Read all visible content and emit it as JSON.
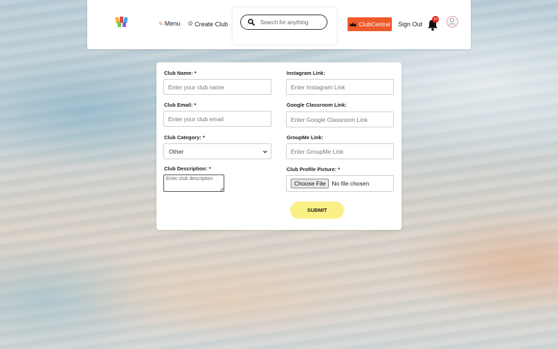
{
  "nav": {
    "menu_label": "Menu",
    "create_club_label": "Create Club",
    "search_placeholder": "Search for anything",
    "club_central_label": "ClubCentral",
    "sign_out_label": "Sign Out",
    "notification_count": "10"
  },
  "form": {
    "club_name": {
      "label": "Club Name: *",
      "placeholder": "Enter your club name",
      "value": ""
    },
    "club_email": {
      "label": "Club Email: *",
      "placeholder": "Enter your club email",
      "value": ""
    },
    "club_category": {
      "label": "Club Category: *",
      "selected": "Other"
    },
    "club_description": {
      "label": "Club Description: *",
      "placeholder": "Enter club description",
      "value": ""
    },
    "instagram": {
      "label": "Instagram Link:",
      "placeholder": "Enter Instagram Link",
      "value": ""
    },
    "google_classroom": {
      "label": "Google Classroom Link:",
      "placeholder": "Enter Google Classroom Link",
      "value": ""
    },
    "groupme": {
      "label": "GroupMe Link:",
      "placeholder": "Enter GroupMe Link",
      "value": ""
    },
    "profile_picture": {
      "label": "Club Profile Picture: *",
      "button_label": "Choose File",
      "status": "No file chosen"
    },
    "submit_label": "SUBMIT"
  },
  "colors": {
    "club_central_bg": "#ef5a2a",
    "submit_bg": "#fbf088",
    "badge_bg": "#e2231a"
  },
  "icons": [
    "app-logo-icon",
    "menu-icon",
    "gear-icon",
    "search-icon",
    "crown-icon",
    "bell-icon",
    "user-avatar-icon",
    "chevron-down-icon"
  ]
}
